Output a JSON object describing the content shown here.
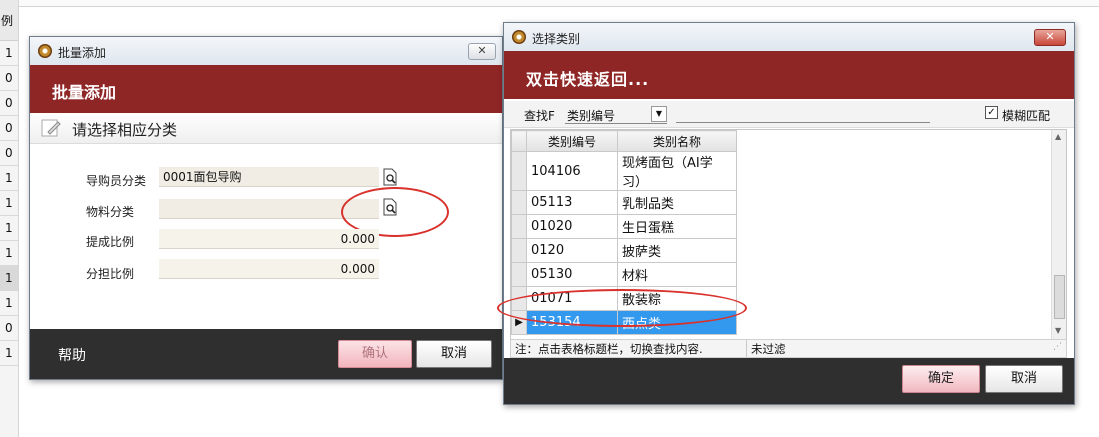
{
  "background": {
    "column_header": "例",
    "cells": [
      "1",
      "0",
      "0",
      "0",
      "0",
      "1",
      "1",
      "1",
      "1",
      "1",
      "1",
      "0",
      "1"
    ],
    "selected_index": 9
  },
  "batch_dialog": {
    "title": "批量添加",
    "banner": "批量添加",
    "section": "请选择相应分类",
    "fields": [
      {
        "label": "导购员分类",
        "value": "0001面包导购"
      },
      {
        "label": "物料分类",
        "value": ""
      },
      {
        "label": "提成比例",
        "value": "0.000"
      },
      {
        "label": "分担比例",
        "value": "0.000"
      }
    ],
    "help": "帮助",
    "confirm": "确认",
    "cancel": "取消"
  },
  "category_dialog": {
    "title": "选择类别",
    "banner": "双击快速返回...",
    "search_label": "查找F",
    "search_field": "类别编号",
    "fuzzy_label": "模糊匹配",
    "fuzzy_checked": true,
    "columns": [
      "类别编号",
      "类别名称"
    ],
    "rows": [
      {
        "code": "104106",
        "name": "现烤面包（AI学习）"
      },
      {
        "code": "05113",
        "name": "乳制品类"
      },
      {
        "code": "01020",
        "name": "生日蛋糕"
      },
      {
        "code": "0120",
        "name": "披萨类"
      },
      {
        "code": "05130",
        "name": "材料"
      },
      {
        "code": "01071",
        "name": "散装粽"
      },
      {
        "code": "153154",
        "name": "西点类"
      }
    ],
    "selected_row": 6,
    "hint": "注：点击表格标题栏，切换查找内容.",
    "filter_status": "未过滤",
    "confirm": "确定",
    "cancel": "取消"
  },
  "colors": {
    "banner": "#8f2626",
    "footer": "#2f2f2f",
    "selection": "#3399ee",
    "annotation": "#d9312c"
  }
}
